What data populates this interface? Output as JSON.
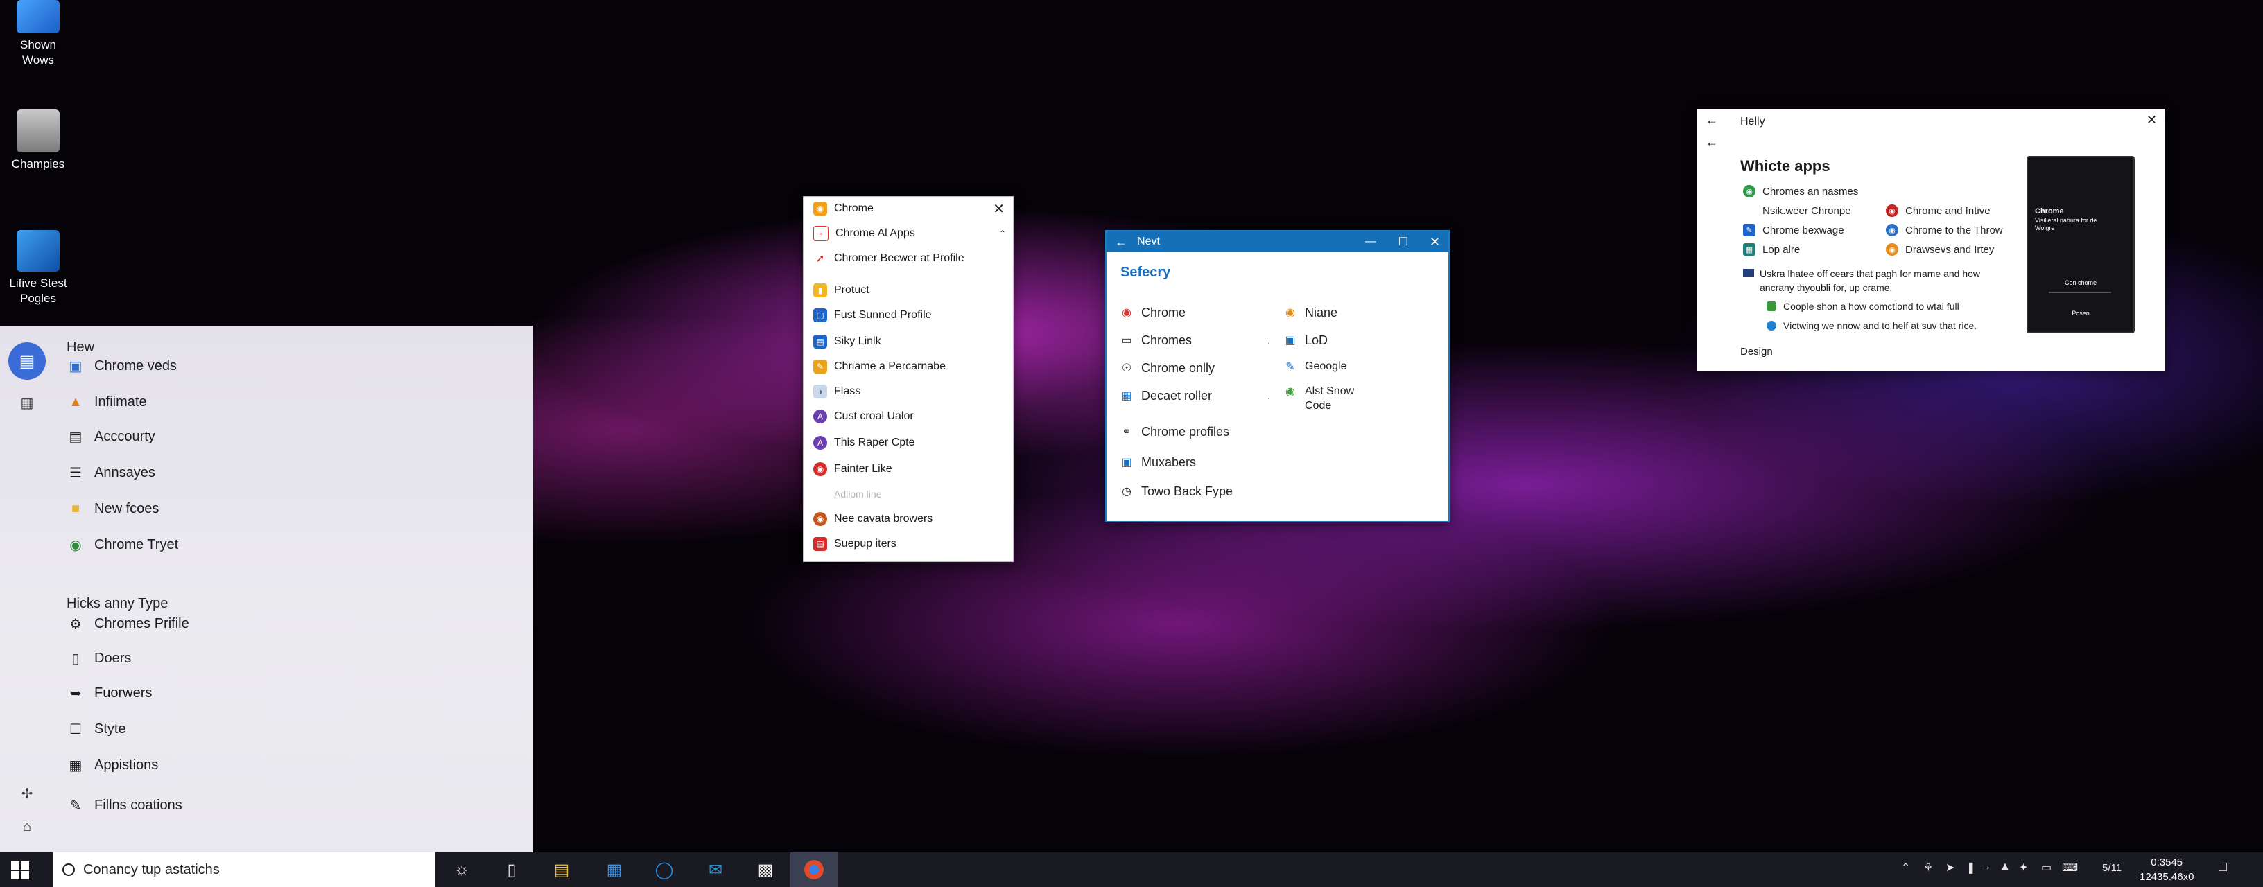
{
  "desktop": {
    "icons": [
      {
        "label_line1": "Shown",
        "label_line2": "Wows"
      },
      {
        "label_line1": "Champies",
        "label_line2": ""
      },
      {
        "label_line1": "Lifive Stest",
        "label_line2": "Pogles"
      }
    ]
  },
  "start_panel": {
    "section1_title": "Hew",
    "section1_items": [
      "Chrome veds",
      "Infiimate",
      "Acccourty",
      "Annsayes",
      "New fcoes",
      "Chrome Tryet"
    ],
    "section2_title": "Hicks anny Type",
    "section2_items": [
      "Chromes Prifile",
      "Doers",
      "Fuorwers",
      "Styte",
      "Appistions",
      "Fillns coations"
    ]
  },
  "chrome_menu": {
    "title": "Chrome",
    "items": [
      "Chrome Al Apps",
      "Chromer Becwer at Profile",
      "Protuct",
      "Fust Sunned Profile",
      "Siky Linlk",
      "Chriame a Percarnabe",
      "Flass",
      "Cust croal Ualor",
      "This Raper Cpte",
      "Fainter Like"
    ],
    "disabled_item": "Adllom line",
    "bottom_items": [
      "Nee cavata browers",
      "Suepup iters"
    ]
  },
  "nevt_window": {
    "title": "Nevt",
    "heading": "Sefecry",
    "left_items": [
      "Chrome",
      "Chromes",
      "Chrome onlly",
      "Decaet roller",
      "Chrome profiles",
      "Muxabers",
      "Towo Back Fype"
    ],
    "right_items": [
      "Niane",
      "LoD",
      "Geoogle",
      "Alst Snow",
      "Code"
    ]
  },
  "apps_window": {
    "title": "Helly",
    "heading": "Whicte apps",
    "row1": "Chromes an nasmes",
    "col_left": [
      "Nsik.weer Chronpe",
      "Chrome bexwage",
      "Lop alre"
    ],
    "col_right": [
      "Chrome and fntive",
      "Chrome to the Throw",
      "Drawsevs and Irtey"
    ],
    "paragraph_line1": "Uskra lhatee off cears that pagh for mame and how",
    "paragraph_line2": "ancrany thyoubli for, up crame.",
    "bullet1": "Coople shon a how comctiond to wtal full",
    "bullet2": "Victwing we nnow and to helf at suv that rice.",
    "footer": "Design",
    "phone_title": "Chrome",
    "phone_sub": "Visilieral nahura for de Wolgre",
    "phone_label": "Con chome",
    "phone_btn": "Posen"
  },
  "taskbar": {
    "search_placeholder": "Conancy tup astatichs",
    "tray_time_top": "0:3545",
    "tray_time_bottom": "12435.46x0",
    "tray_date": "5/11"
  },
  "colors": {
    "accent": "#1670b8",
    "start_accent": "#3b6bd6"
  }
}
